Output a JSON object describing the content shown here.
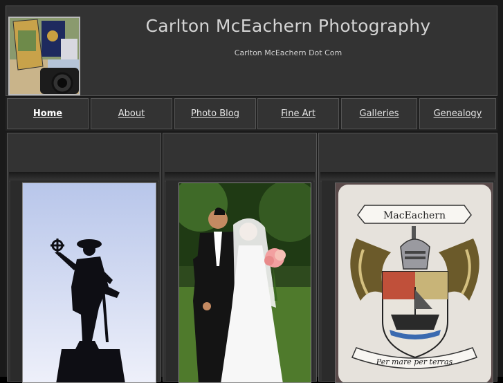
{
  "header": {
    "title": "Carlton McEachern Photography",
    "subtitle": "Carlton McEachern Dot Com"
  },
  "nav": {
    "items": [
      {
        "label": "Home",
        "active": true
      },
      {
        "label": "About"
      },
      {
        "label": "Photo Blog"
      },
      {
        "label": "Fine Art"
      },
      {
        "label": "Galleries"
      },
      {
        "label": "Genealogy"
      }
    ]
  },
  "colors": {
    "background": "#1a1a1a",
    "panel": "#333333",
    "border": "#555555",
    "text": "#d4d4d4"
  },
  "gallery": {
    "photos": [
      {
        "icon": "statue-silhouette-photo"
      },
      {
        "icon": "wedding-couple-photo"
      },
      {
        "icon": "coat-of-arms-photo",
        "banner_text": "MacEachern",
        "motto": "Per mare per terras"
      }
    ]
  }
}
